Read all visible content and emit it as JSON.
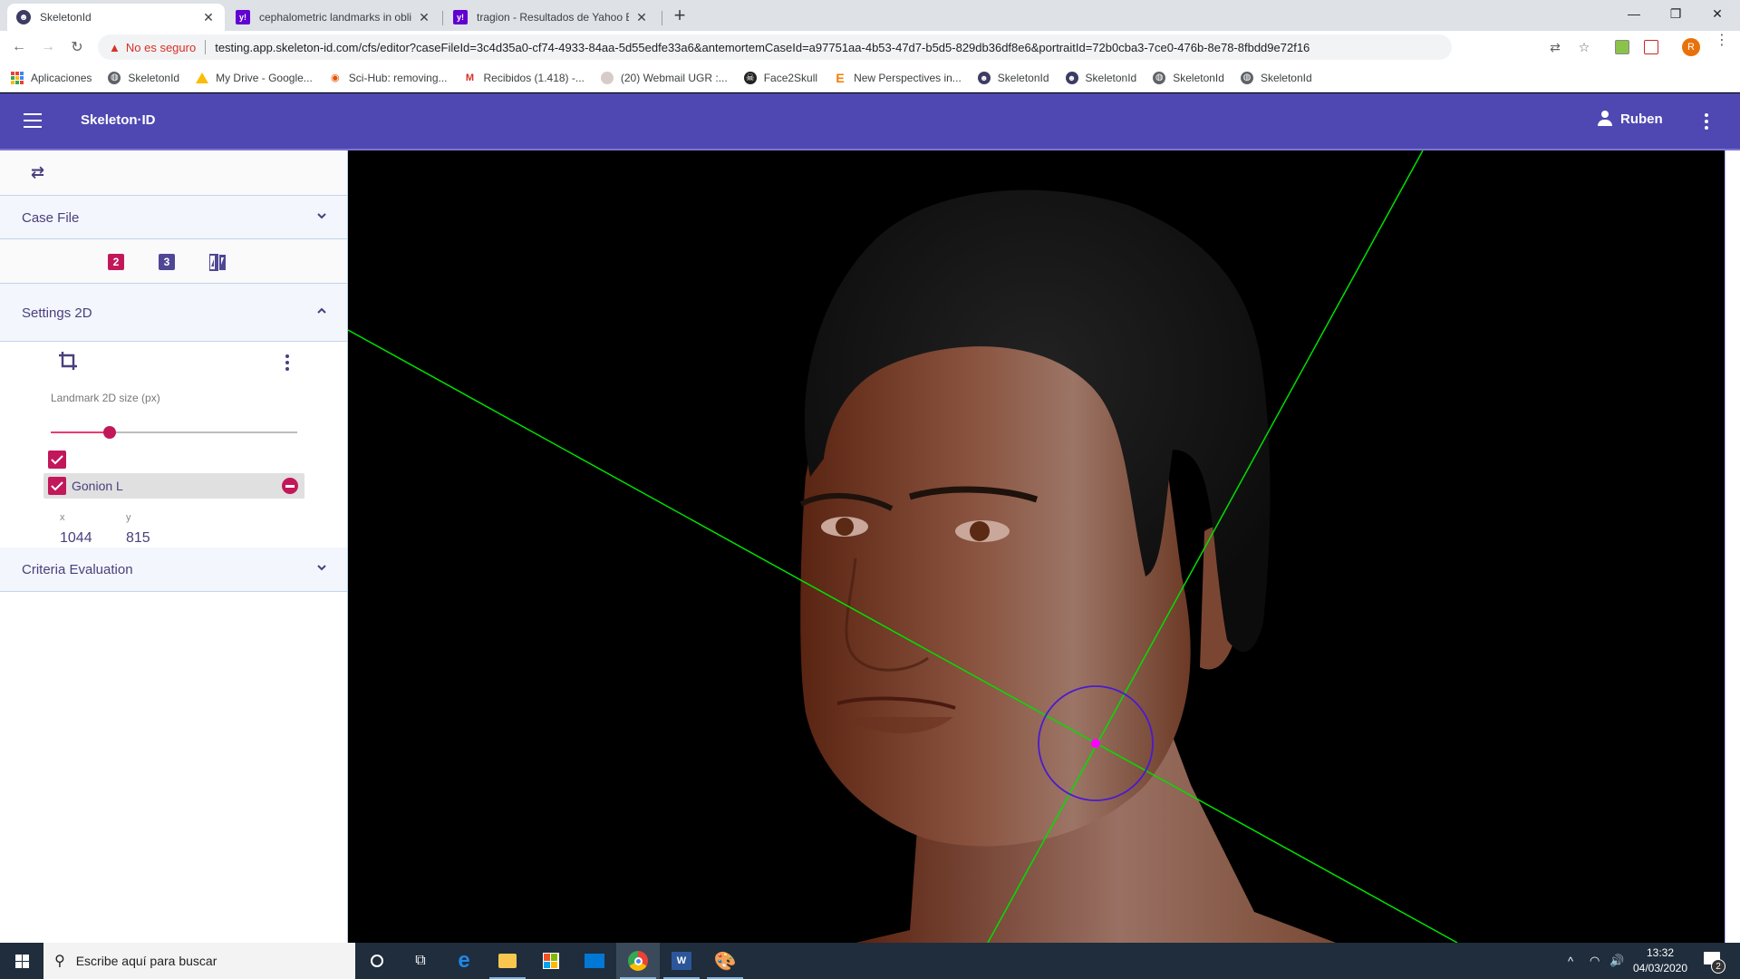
{
  "browser": {
    "tabs": [
      {
        "title": "SkeletonId",
        "favicon": "skeletonid-icon",
        "active": true
      },
      {
        "title": "cephalometric landmarks in obliq",
        "favicon": "yahoo-icon",
        "active": false
      },
      {
        "title": "tragion - Resultados de Yahoo Es",
        "favicon": "yahoo-icon",
        "active": false
      }
    ],
    "new_tab_label": "+",
    "security_label": "No es seguro",
    "url": "testing.app.skeleton-id.com/cfs/editor?caseFileId=3c4d35a0-cf74-4933-84aa-5d55edfe33a6&antemortemCaseId=a97751aa-4b53-47d7-b5d5-829db36df8e6&portraitId=72b0cba3-7ce0-476b-8e78-8fbdd9e72f16",
    "profile_initial": "R",
    "bookmarks": [
      {
        "label": "Aplicaciones",
        "icon": "apps-grid-icon"
      },
      {
        "label": "SkeletonId",
        "icon": "globe-icon"
      },
      {
        "label": "My Drive - Google...",
        "icon": "google-drive-icon"
      },
      {
        "label": "Sci-Hub: removing...",
        "icon": "scihub-icon"
      },
      {
        "label": "Recibidos (1.418) -...",
        "icon": "gmail-icon"
      },
      {
        "label": "(20) Webmail UGR :...",
        "icon": "ugr-icon"
      },
      {
        "label": "Face2Skull",
        "icon": "skull-icon"
      },
      {
        "label": "New Perspectives in...",
        "icon": "elsevier-icon"
      },
      {
        "label": "SkeletonId",
        "icon": "skeletonid-icon"
      },
      {
        "label": "SkeletonId",
        "icon": "skeletonid-icon"
      },
      {
        "label": "SkeletonId",
        "icon": "globe-icon"
      },
      {
        "label": "SkeletonId",
        "icon": "globe-icon"
      }
    ]
  },
  "app": {
    "title": "Skeleton·ID",
    "user_name": "Ruben",
    "brand_color": "#4f48b2",
    "accent_color": "#c2185b"
  },
  "sidebar": {
    "case_file_label": "Case File",
    "mode_buttons": [
      {
        "label": "2",
        "name": "2d-mode",
        "active": true
      },
      {
        "label": "3",
        "name": "3d-mode",
        "active": false
      },
      {
        "label": "",
        "name": "split-compare-mode",
        "active": false
      }
    ],
    "settings_label": "Settings 2D",
    "landmark_size_label": "Landmark 2D size (px)",
    "landmark_size_fraction": 0.24,
    "select_all_checked": true,
    "landmarks": [
      {
        "name": "Gonion L",
        "checked": true,
        "x": "1044",
        "y": "815"
      }
    ],
    "x_label": "x",
    "y_label": "y",
    "criteria_label": "Criteria Evaluation"
  },
  "viewport": {
    "line_color": "#00e000",
    "landmark_color": "#ff00ff",
    "circle_color": "#4a1ad0"
  },
  "taskbar": {
    "search_placeholder": "Escribe aquí para buscar",
    "time": "13:32",
    "date": "04/03/2020",
    "notification_count": "2"
  }
}
